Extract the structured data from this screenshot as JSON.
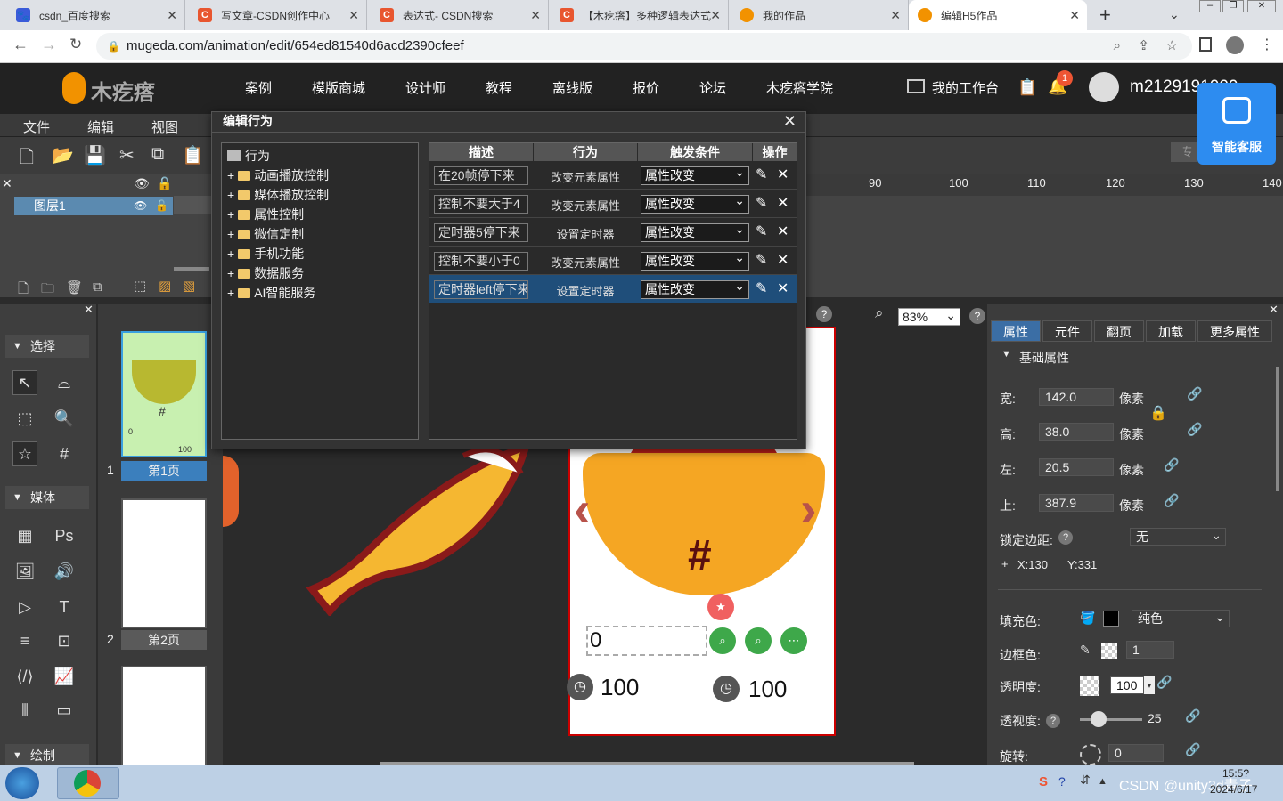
{
  "browser": {
    "tabs": [
      {
        "label": "csdn_百度搜索",
        "fav_color": "#3a5bd9",
        "fav_glyph": "🐾"
      },
      {
        "label": "写文章-CSDN创作中心",
        "fav_color": "#e8562f",
        "fav_glyph": "C"
      },
      {
        "label": "表达式- CSDN搜索",
        "fav_color": "#e8562f",
        "fav_glyph": "C"
      },
      {
        "label": "【木疙瘩】多种逻辑表达式",
        "fav_color": "#e8562f",
        "fav_glyph": "C"
      },
      {
        "label": "我的作品",
        "fav_color": "#f29200",
        "fav_glyph": "●"
      },
      {
        "label": "编辑H5作品",
        "fav_color": "#f29200",
        "fav_glyph": "●"
      }
    ],
    "url": "mugeda.com/animation/edit/654ed81540d6acd2390cfeef"
  },
  "site": {
    "logo": "木疙瘩",
    "nav": [
      "案例",
      "模版商城",
      "设计师",
      "教程",
      "离线版",
      "报价",
      "论坛",
      "木疙瘩学院"
    ],
    "workspace": "我的工作台",
    "notif_count": "1",
    "username": "m2129191000",
    "ai_service": "智能客服"
  },
  "editor": {
    "menus": [
      "文件",
      "编辑",
      "视图"
    ],
    "layer_name": "图层1",
    "ruler_ticks": [
      "90",
      "100",
      "110",
      "120",
      "130",
      "140"
    ],
    "sections": {
      "select": "选择",
      "media": "媒体",
      "draw": "绘制"
    },
    "pages": [
      {
        "num": "1",
        "label": "第1页"
      },
      {
        "num": "2",
        "label": "第2页"
      }
    ],
    "zoom": "83%",
    "thumb_text": {
      "counter": "0",
      "score": "100"
    }
  },
  "dialog": {
    "title": "编辑行为",
    "tree_root": "行为",
    "tree_items": [
      "动画播放控制",
      "媒体播放控制",
      "属性控制",
      "微信定制",
      "手机功能",
      "数据服务",
      "AI智能服务"
    ],
    "columns": [
      "描述",
      "行为",
      "触发条件",
      "操作"
    ],
    "rows": [
      {
        "desc": "在20帧停下来",
        "action": "改变元素属性",
        "trigger": "属性改变"
      },
      {
        "desc": "控制不要大于4",
        "action": "改变元素属性",
        "trigger": "属性改变"
      },
      {
        "desc": "定时器5停下来",
        "action": "设置定时器",
        "trigger": "属性改变"
      },
      {
        "desc": "控制不要小于0",
        "action": "改变元素属性",
        "trigger": "属性改变"
      },
      {
        "desc": "定时器left停下来",
        "action": "设置定时器",
        "trigger": "属性改变"
      }
    ]
  },
  "properties": {
    "tabs": [
      "属性",
      "元件",
      "翻页",
      "加载",
      "更多属性"
    ],
    "section": "基础属性",
    "width_label": "宽:",
    "width": "142.0",
    "height_label": "高:",
    "height": "38.0",
    "left_label": "左:",
    "left": "20.5",
    "top_label": "上:",
    "top": "387.9",
    "unit": "像素",
    "lock_label": "锁定边距:",
    "lock_value": "无",
    "x_coord": "X:130",
    "y_coord": "Y:331",
    "fill_label": "填充色:",
    "fill_type": "纯色",
    "border_label": "边框色:",
    "border_width": "1",
    "opacity_label": "透明度:",
    "opacity": "100",
    "perspective_label": "透视度:",
    "perspective": "25",
    "rotate_label": "旋转:",
    "rotate": "0"
  },
  "canvas_text": {
    "counter": "0",
    "score_a": "100",
    "score_b": "100"
  },
  "taskbar": {
    "time": "15:5?",
    "date": "2024/6/17",
    "watermark": "CSDN @unity3d青子"
  }
}
